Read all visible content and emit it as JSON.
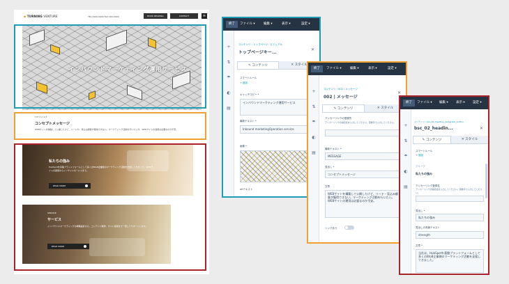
{
  "website": {
    "logo": "TURNING",
    "logo_sub": "VENTURE",
    "tel": "TEL 0000-0000  FAX 000-0000",
    "btn1": "BOOK READING",
    "btn2": "CONTACT",
    "menu_icon": "hamburger-icon",
    "hero_text": "インバウンドマーケティング運用サービス",
    "message_small": "MESSAGE",
    "message_title": "コンセプトメッセージ",
    "message_body": "WEBサイトを構築して公開したけど、リードや、見込み顧客が獲得できない。マーケティング活動を行いたいが、WEBサイトの運用は必要なのか不安。",
    "section1_title": "私たちの強み",
    "section1_body": "HubSpotを基盤プラットフォームとして多くのBtoB企業様のマーケティング活動を支援してきました。WEBサイトの運用からインサイドセールスまで。",
    "section1_btn": "READ MORE",
    "section2_small": "SERVICE",
    "section2_title": "サービス",
    "section2_body": "インバウンドマーケティングの戦略設計から、コンテンツ制作、サイト運用まで一貫してサポートします。",
    "section2_btn": "READ MORE"
  },
  "frame_colors": {
    "blue": "#1e9bb5",
    "orange": "#f0a030",
    "red": "#a8222a"
  },
  "toolbar": {
    "done": "終了",
    "file": "ファイル",
    "edit": "編集",
    "view": "表示",
    "settings": "設定"
  },
  "panel1": {
    "crumb": "コンテンツ › トップページ・ビジュアル",
    "title": "トップページキー...",
    "tab_content": "コンテンツ",
    "tab_style": "スタイル",
    "smart_rule": "スマートルール",
    "add": "+ 追加",
    "catch_label": "キャッチコピー *",
    "catch_value": "インバウンドマーケティング運用サービス",
    "bg_text_label": "最新テキスト *",
    "bg_text_value": "Inbound marketingOperation service",
    "image_label": "画像 *",
    "image_link": "置換",
    "alt_label": "altテキスト"
  },
  "panel2": {
    "crumb": "コンテンツ › 002 › メッセージ",
    "title": "002 | メッセージ",
    "tab_content": "コンテンツ",
    "tab_style": "スタイル",
    "anchor_label": "アンカーリンクの登録先",
    "anchor_help": "アンカーリンクの指定名を入力してください。英数字で入力してください。",
    "bg_label": "最新テキスト *",
    "bg_value": "MESSAGE",
    "heading_label": "見出し *",
    "heading_value": "コンセプトメッセージ",
    "body_label": "文章",
    "body_value": "WEBサイトを構築して公開したけど、リード・見込み顧客が獲得できない。マーケティング活動を行いたい。WEBサイトの運用は必要なのか不安。",
    "link_label": "リンクあり"
  },
  "panel3": {
    "crumb": "コンテンツ › bsc_02_heading_paragraph_button",
    "title": "bsc_02_headin...",
    "tab_content": "コンテンツ",
    "tab_style": "スタイル",
    "smart_rule": "スマートルール",
    "add": "+ 追加",
    "group": "グループ",
    "item_title": "私たちの強み",
    "anchor_label": "アンカーリンク登録名",
    "anchor_help": "アンカーリンクの指定名を入力してください。英数字で入力してください。",
    "heading_label": "見出し *",
    "heading_value": "私たちの強み",
    "bg_label": "見出しの背景テキスト",
    "bg_value": "strength",
    "body_label": "文章 *",
    "body_value": "当社は、HubSpotを基盤プラットフォームとして多くのBtoB企業様のマーケティング活動を支援してきました。"
  }
}
